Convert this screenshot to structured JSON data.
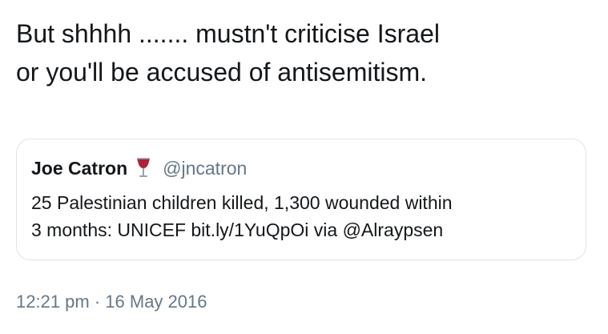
{
  "tweet": {
    "text_line_1": "But shhhh ....... mustn't criticise Israel",
    "text_line_2": "or you'll be accused of antisemitism.",
    "timestamp": "12:21 pm · 16 May 2016"
  },
  "quoted_tweet": {
    "author_name": "Joe Catron",
    "author_emoji": "wine-glass-icon",
    "author_handle": "@jncatron",
    "text_line_1": "25 Palestinian children killed, 1,300 wounded within",
    "text_line_2": "3 months: UNICEF bit.ly/1YuQpOi via @Alraypsen"
  },
  "colors": {
    "text_primary": "#14171a",
    "text_secondary": "#657786",
    "card_border": "#dfe3e7",
    "wine": "#b0213a"
  }
}
